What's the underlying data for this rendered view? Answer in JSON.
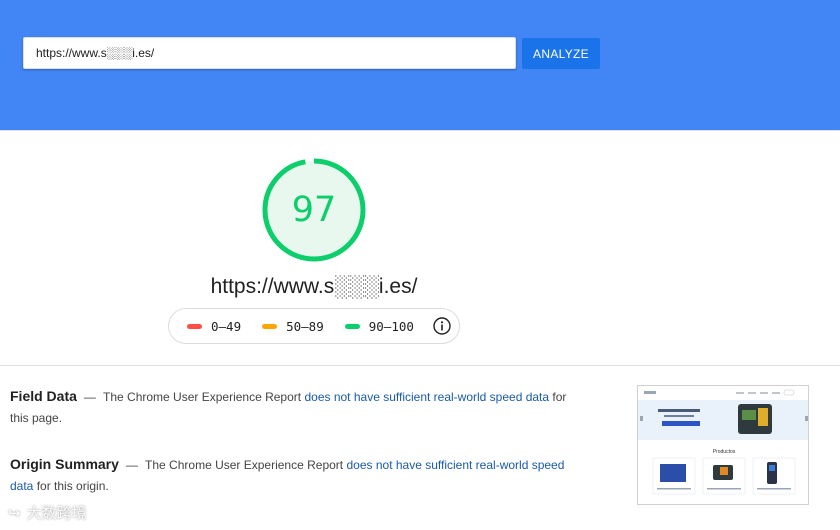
{
  "search": {
    "url_value": "https://www.s░░░i.es/",
    "button_label": "ANALYZE"
  },
  "score": {
    "value": "97",
    "fraction": 0.97,
    "color": "#0cce6b",
    "track_color": "#e8f8ee"
  },
  "tested_url": "https://www.s░░░i.es/",
  "legend": [
    {
      "label": "0–49",
      "color": "#ff4e42"
    },
    {
      "label": "50–89",
      "color": "#ffa400"
    },
    {
      "label": "90–100",
      "color": "#0cce6b"
    }
  ],
  "field_data": {
    "title": "Field Data",
    "dash": "—",
    "text_before": "The Chrome User Experience Report",
    "link": "does not have sufficient real-world speed data",
    "text_after": "for this page."
  },
  "origin_summary": {
    "title": "Origin Summary",
    "dash": "—",
    "text_before": "The Chrome User Experience Report",
    "link": "does not have sufficient real-world speed data",
    "text_after": "for this origin."
  },
  "thumbnail": {
    "products_label": "Productos"
  },
  "watermark": {
    "text": "大数跨境"
  },
  "colors": {
    "header": "#4285f4",
    "button": "#1a73e8",
    "link": "#1a5aa8"
  }
}
